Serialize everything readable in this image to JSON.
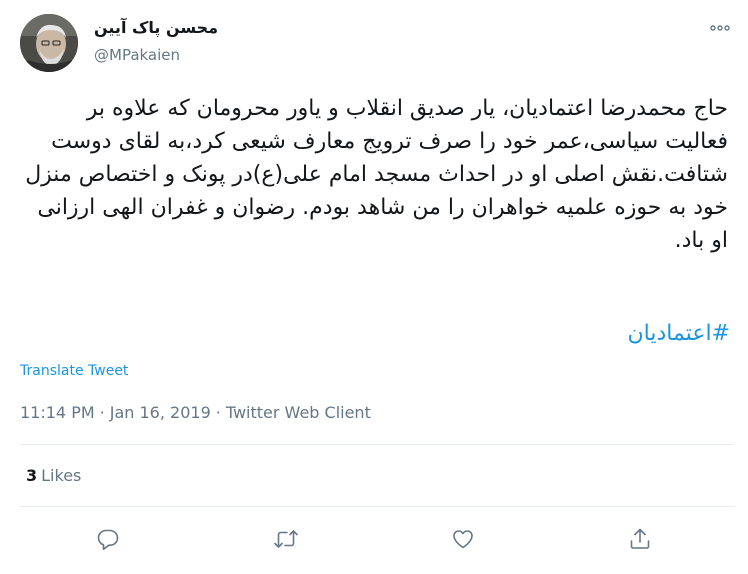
{
  "author": {
    "display_name": "محسن پاک آیین",
    "handle": "@MPakaien"
  },
  "tweet": {
    "text": "حاج محمدرضا اعتمادیان، یار صدیق انقلاب و یاور محرومان که علاوه بر فعالیت سیاسی،عمر خود را صرف ترویج معارف شیعی کرد،به لقای دوست شتافت.نقش اصلی او در احداث مسجد امام علی(ع)در پونک و اختصاص منزل خود به حوزه علمیه خواهران را من شاهد بودم. رضوان و غفران الهی ارزانی او باد.",
    "hashtag": "#اعتمادیان",
    "translate_label": "Translate Tweet",
    "time": "11:14 PM",
    "date": "Jan 16, 2019",
    "client": "Twitter Web Client",
    "separator": "·"
  },
  "stats": {
    "likes_count": "3",
    "likes_label": "Likes"
  },
  "icons": {
    "more": "more-horizontal-icon",
    "reply": "reply-icon",
    "retweet": "retweet-icon",
    "like": "heart-icon",
    "share": "share-icon"
  },
  "colors": {
    "link": "#1b95e0",
    "secondary_text": "#657786",
    "divider": "#e6ecf0",
    "icon": "#657786"
  }
}
